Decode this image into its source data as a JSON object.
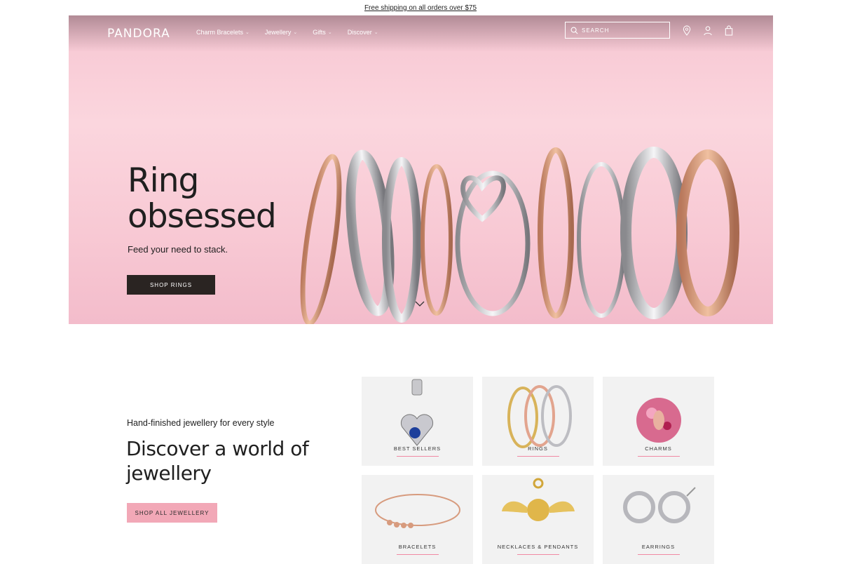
{
  "announcement": "Free shipping on all orders over $75",
  "header": {
    "logo": "PANDORA",
    "nav": [
      {
        "label": "Charm Bracelets"
      },
      {
        "label": "Jewellery"
      },
      {
        "label": "Gifts"
      },
      {
        "label": "Discover"
      }
    ],
    "search_placeholder": "SEARCH",
    "icons": [
      "location-pin-icon",
      "account-icon",
      "shopping-bag-icon"
    ]
  },
  "hero": {
    "title_line1": "Ring",
    "title_line2": "obsessed",
    "subtitle": "Feed your need to stack.",
    "cta": "SHOP RINGS"
  },
  "promo": {
    "kicker": "Hand-finished jewellery for every style",
    "title_line1": "Discover a world of",
    "title_line2": "jewellery",
    "cta": "SHOP ALL JEWELLERY"
  },
  "categories": [
    {
      "label": "BEST SELLERS"
    },
    {
      "label": "RINGS"
    },
    {
      "label": "CHARMS"
    },
    {
      "label": "BRACELETS"
    },
    {
      "label": "NECKLACES & PENDANTS"
    },
    {
      "label": "EARRINGS"
    }
  ],
  "colors": {
    "accent_pink": "#f2a8b7",
    "dark_button": "#2a2422",
    "hero_bg": "#f8c9d4"
  }
}
